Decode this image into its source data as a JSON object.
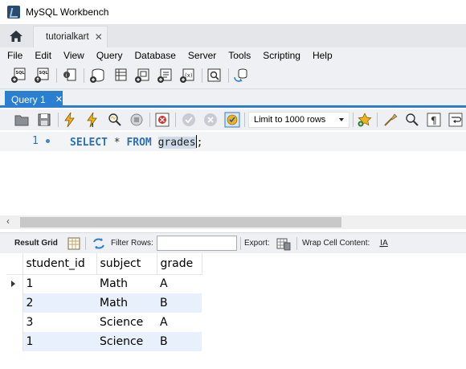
{
  "window": {
    "title": "MySQL Workbench"
  },
  "connection_tab": {
    "label": "tutorialkart",
    "close": "✕"
  },
  "menu": [
    "File",
    "Edit",
    "View",
    "Query",
    "Database",
    "Server",
    "Tools",
    "Scripting",
    "Help"
  ],
  "main_toolbar_icons": [
    "new-sql-tab-icon",
    "open-sql-script-icon",
    "inspector-icon",
    "create-schema-icon",
    "create-table-icon",
    "create-view-icon",
    "create-procedure-icon",
    "create-function-icon",
    "search-table-data-icon",
    "reconnect-icon"
  ],
  "query_tab": {
    "label": "Query 1",
    "close": "✕"
  },
  "editor_toolbar": {
    "icons": [
      "open-file-icon",
      "save-file-icon",
      "execute-icon",
      "execute-current-icon",
      "explain-icon",
      "stop-icon",
      "toggle-error-icon",
      "commit-icon",
      "rollback-icon",
      "autocommit-icon"
    ],
    "limit_label": "Limit to 1000 rows",
    "right_icons": [
      "add-snippet-icon",
      "beautify-icon",
      "find-icon",
      "invisible-chars-icon",
      "word-wrap-icon"
    ]
  },
  "editor": {
    "line_number": "1",
    "tokens": {
      "select": "SELECT",
      "star": "*",
      "from": "FROM",
      "table": "grades",
      "semicolon": ";"
    }
  },
  "result_toolbar": {
    "result_grid": "Result Grid",
    "filter_rows": "Filter Rows:",
    "filter_value": "",
    "export": "Export:",
    "wrap": "Wrap Cell Content:",
    "wrap_glyph": "I̲A"
  },
  "grid": {
    "columns": [
      "student_id",
      "subject",
      "grade"
    ],
    "rows": [
      [
        "1",
        "Math",
        "A"
      ],
      [
        "2",
        "Math",
        "B"
      ],
      [
        "3",
        "Science",
        "A"
      ],
      [
        "1",
        "Science",
        "B"
      ]
    ]
  },
  "colors": {
    "accent": "#2b7fd0",
    "keyword": "#2d6fb8",
    "alt_row": "#e8f0fb",
    "chrome": "#eef0f3"
  }
}
